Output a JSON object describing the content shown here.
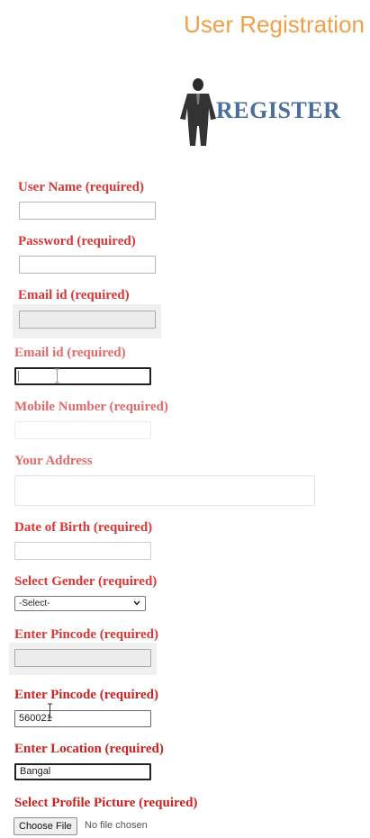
{
  "page": {
    "title": "User Registration"
  },
  "logo": {
    "word": "REGISTER"
  },
  "colors": {
    "label_red": "#d93636",
    "title_orange": "#f0a04a",
    "logo_blue": "#4b6e9c"
  },
  "form": {
    "username_label": "User Name (required)",
    "username_value": "",
    "password_label": "Password (required)",
    "password_value": "",
    "email_disabled_label": "Email id (required)",
    "email_label": "Email id (required)",
    "email_value": "",
    "mobile_label": "Mobile Number (required)",
    "mobile_value": "",
    "address_label": "Your Address",
    "address_value": "",
    "dob_label": "Date of Birth (required)",
    "dob_value": "",
    "gender_label": "Select Gender (required)",
    "gender_selected": "-Select-",
    "pincode_disabled_label": "Enter Pincode (required)",
    "pincode_label": "Enter Pincode (required)",
    "pincode_value": "560021",
    "location_label": "Enter Location (required)",
    "location_value": "Bangal",
    "picture_label": "Select Profile Picture (required)",
    "file_button": "Choose File",
    "file_status": "No file chosen"
  }
}
